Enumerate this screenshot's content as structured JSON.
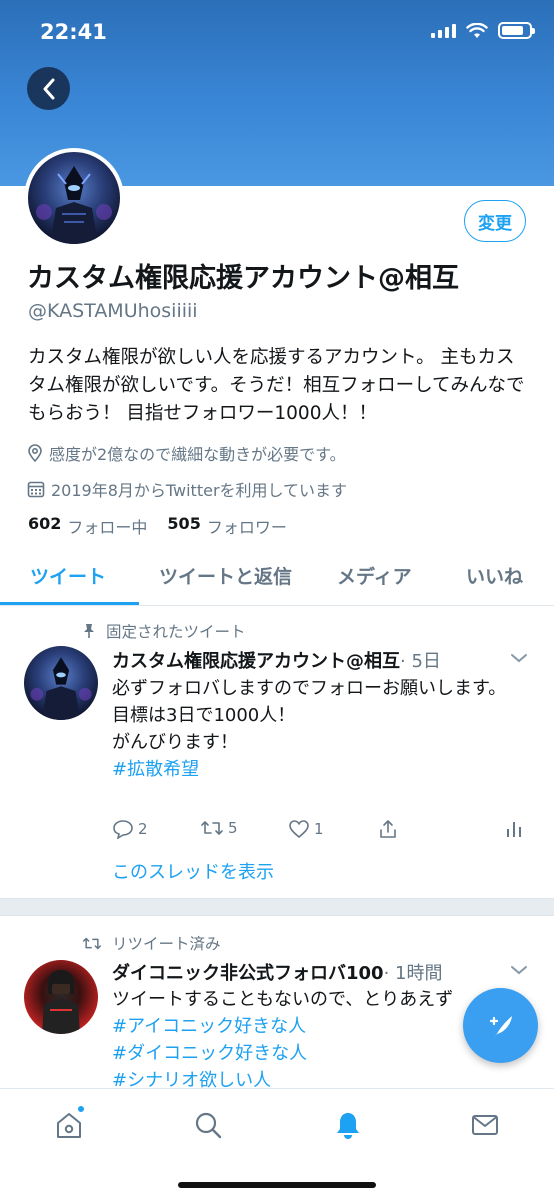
{
  "status_bar": {
    "time": "22:41"
  },
  "profile": {
    "edit_label": "変更",
    "display_name": "カスタム権限応援アカウント@相互",
    "handle": "@KASTAMUhosiiiii",
    "bio": "カスタム権限が欲しい人を応援するアカウント。 主もカスタム権限が欲しいです。そうだ！相互フォローしてみんなでもらおう！ 目指せフォロワー1000人！！",
    "location": "感度が2億なので繊細な動きが必要です。",
    "joined": "2019年8月からTwitterを利用しています",
    "following_count": "602",
    "following_label": "フォロー中",
    "followers_count": "505",
    "followers_label": "フォロワー"
  },
  "tabs": [
    {
      "label": "ツイート",
      "active": true
    },
    {
      "label": "ツイートと返信",
      "active": false
    },
    {
      "label": "メディア",
      "active": false
    },
    {
      "label": "いいね",
      "active": false
    }
  ],
  "pinned_tweet": {
    "context_label": "固定されたツイート",
    "author_name": "カスタム権限応援アカウント@相互",
    "time": "· 5日",
    "body_line1": "必ずフォロバしますのでフォローお願いします。",
    "body_line2": "目標は3日で1000人！",
    "body_line3": "がんびります！",
    "hashtag": "#拡散希望",
    "reply_count": "2",
    "retweet_count": "5",
    "like_count": "1",
    "thread_link": "このスレッドを表示"
  },
  "retweet": {
    "context_label": "リツイート済み",
    "author_name": "ダイコニック非公式フォロバ100",
    "time": "· 1時間",
    "body_line1": "ツイートすることもないので、とりあえず",
    "hashtag1": "#アイコニック好きな人",
    "hashtag2": "#ダイコニック好きな人",
    "hashtag3": "#シナリオ欲しい人"
  },
  "colors": {
    "accent": "#1da1f2",
    "header": "#3a86d6",
    "secondary_text": "#657786",
    "primary_text": "#14171a"
  },
  "icons": {
    "back": "chevron-left-icon",
    "location": "location-pin-icon",
    "calendar": "calendar-icon",
    "pin": "pin-icon",
    "retweet_context": "retweet-icon",
    "reply": "reply-icon",
    "retweet": "retweet-icon",
    "like": "heart-icon",
    "share": "share-icon",
    "analytics": "analytics-icon",
    "compose": "compose-tweet-icon",
    "home": "home-icon",
    "search": "search-icon",
    "notifications": "bell-icon",
    "messages": "mail-icon"
  }
}
